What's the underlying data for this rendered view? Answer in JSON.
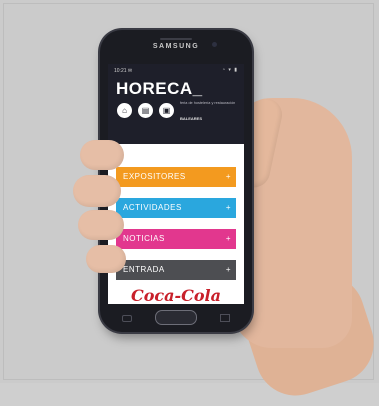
{
  "device": {
    "brand": "SAMSUNG"
  },
  "status_bar": {
    "time": "10:21 ✉",
    "icons": "◔ ▾ ▮"
  },
  "app": {
    "logo": "HORECA_",
    "subtitle": "feria de hostelería y restauración",
    "subtitle_bold": "BALEARES",
    "header_buttons": [
      {
        "icon": "home-icon",
        "glyph": "⌂"
      },
      {
        "icon": "document-icon",
        "glyph": "▤"
      },
      {
        "icon": "calendar-icon",
        "glyph": "▣"
      }
    ]
  },
  "menu": [
    {
      "label": "EXPOSITORES",
      "arrow": "+",
      "color": "#f39a1f"
    },
    {
      "label": "ACTIVIDADES",
      "arrow": "+",
      "color": "#2aa7de"
    },
    {
      "label": "NOTICIAS",
      "arrow": "+",
      "color": "#e2378e"
    },
    {
      "label": "ENTRADA",
      "arrow": "+",
      "color": "#4d4e52"
    }
  ],
  "sponsor": {
    "logo_text": "Coca-Cola"
  }
}
